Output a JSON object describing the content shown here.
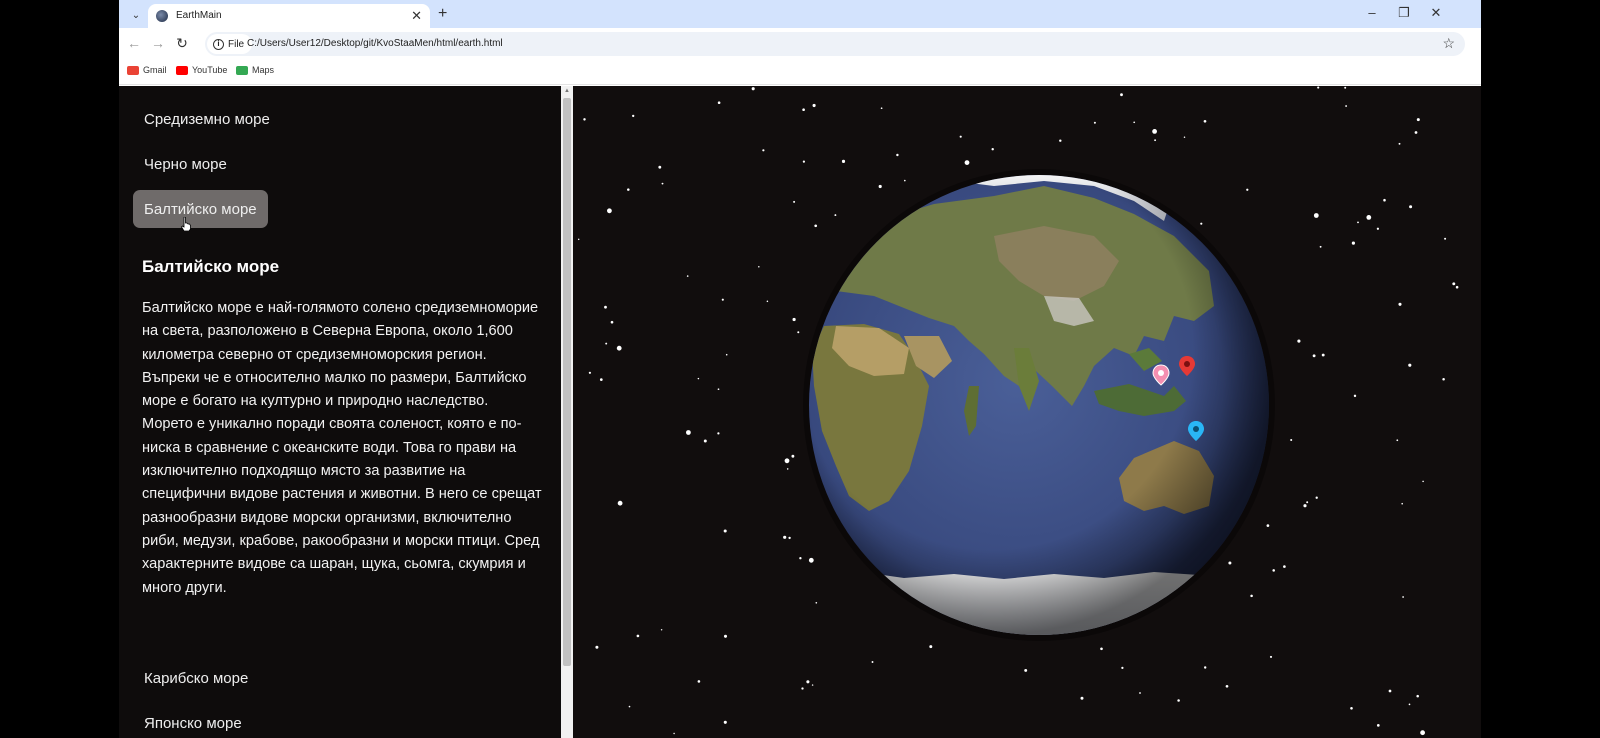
{
  "browser": {
    "tab_title": "EarthMain",
    "chip_label": "File",
    "url": "C:/Users/User12/Desktop/git/KvoStaaMen/html/earth.html",
    "bookmarks": [
      {
        "label": "Gmail",
        "color": "#ea4335"
      },
      {
        "label": "YouTube",
        "color": "#ff0000"
      },
      {
        "label": "Maps",
        "color": "#34a853"
      }
    ]
  },
  "sidebar": {
    "top_items": [
      "Средиземно море",
      "Черно море"
    ],
    "active_item": "Балтийско море",
    "bottom_items": [
      "Карибско море",
      "Японско море"
    ],
    "section_title": "Балтийско море",
    "section_body": "Балтийско море е най-голямото солено средиземномoрие на света, разположено в Северна Европа, около 1,600 километра северно от средиземноморския регион. Въпреки че е относително малко по размери, Балтийско море е богато на културно и природно наследство. Морето е уникално поради своята соленост, която е по-ниска в сравнение с океанските води. Това го прави на изключително подходящо място за развитие на специфични видове растения и животни. В него се срещат разнообразни видове морски организми, включително риби, медузи, крабове, ракообразни и морски птици. Сред характерните видове са шаран, щука, сьомга, скумрия и много други."
  },
  "globe": {
    "markers": [
      {
        "name": "pink-marker",
        "color": "#f48fb1"
      },
      {
        "name": "red-marker",
        "color": "#e53935"
      },
      {
        "name": "blue-marker",
        "color": "#29b6f6"
      }
    ]
  }
}
